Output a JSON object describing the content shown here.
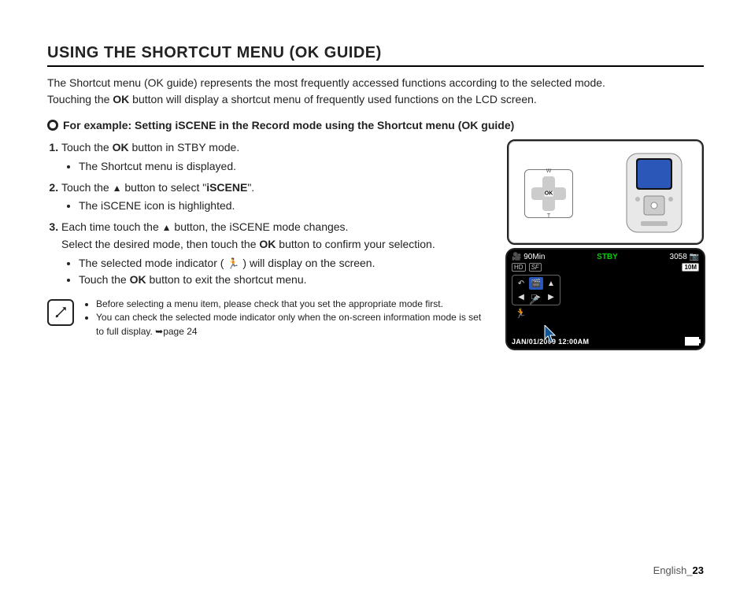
{
  "title": "USING THE SHORTCUT MENU (OK GUIDE)",
  "intro": {
    "line1": "The Shortcut menu (OK guide) represents the most frequently accessed functions according to the selected mode.",
    "line2_a": "Touching the ",
    "ok": "OK",
    "line2_b": " button will display a shortcut menu of frequently used functions on the LCD screen."
  },
  "subhead": "For example: Setting iSCENE in the Record mode using the Shortcut menu (OK guide)",
  "steps": {
    "s1": {
      "a": "Touch the ",
      "ok": "OK",
      "b": " button in STBY mode.",
      "sub1": "The Shortcut menu is displayed."
    },
    "s2": {
      "a": "Touch the ",
      "tri": "▲",
      "b": " button to select \"",
      "iscene": "iSCENE",
      "c": "\".",
      "sub1": "The iSCENE icon is highlighted."
    },
    "s3": {
      "a": "Each time touch the ",
      "tri": "▲",
      "b": " button, the iSCENE mode changes.",
      "line2a": "Select the desired mode, then touch the ",
      "ok": "OK",
      "line2b": " button to confirm your selection.",
      "sub1a": "The selected mode indicator ( ",
      "run": "🏃",
      "sub1b": " ) will display on the screen.",
      "sub2a": "Touch the ",
      "ok2": "OK",
      "sub2b": " button to exit the shortcut menu."
    }
  },
  "notes": {
    "n1": "Before selecting a menu item, please check that you set the appropriate mode first.",
    "n2": "You can check the selected mode indicator only when the on-screen information mode is set to full display. ➥page 24"
  },
  "device_pad": {
    "ok": "OK",
    "w": "W",
    "t": "T"
  },
  "lcd": {
    "time_remaining": "90Min",
    "status": "STBY",
    "count": "3058",
    "hd": "HD",
    "sf": "SF",
    "res_badge": "10M",
    "timestamp": "JAN/01/2009 12:00AM",
    "menu_icons": {
      "back": "↶",
      "rec": "🎬",
      "up": "▲",
      "left": "◀",
      "center": "□▸",
      "right": "▶",
      "down": "🎤"
    },
    "running": "🏃"
  },
  "footer": {
    "lang": "English",
    "sep": "_",
    "page": "23"
  }
}
